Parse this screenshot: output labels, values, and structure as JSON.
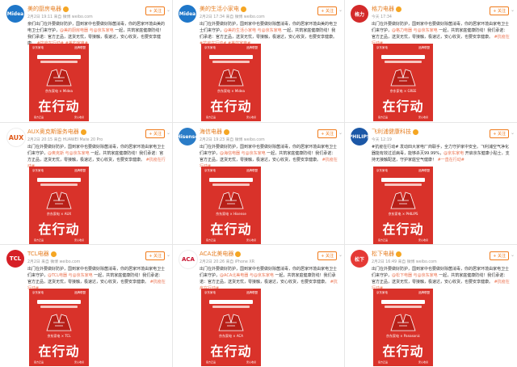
{
  "posts": [
    {
      "user": "美的厨房电器",
      "meta": "2月2日 19:11 来自 微博 weibo.com",
      "follow": "+ 关注",
      "avatar": "Midea",
      "text_a": "亲们出门在外要做好防护，国到家中也要做好除菌消毒，你的居家环境由美的电卫士们来守护，",
      "text_hl": "@美的厨房电器 与@京东家电",
      "text_b": " 一起，共筑家庭健康防线！我们承诺：官方正品，送货无忧，零接触，极速达，安心收货，也要安享健康。",
      "tags": "#抗疫在行动# #美的家电#",
      "brands": "京东家电 × Midea",
      "slogan": "在行动"
    },
    {
      "user": "美的生活小家电",
      "meta": "2月2日 17:34 来自 微博 weibo.com",
      "follow": "+ 关注",
      "avatar": "Midea",
      "text_a": "出门在外要做好防护，国到家中也要做好除菌消毒，你的居家环境由美的电卫士们来守护，",
      "text_hl": "@美的生活小家电 与@京东家电",
      "text_b": " 一起，共筑家庭健康防线！我们承诺：官方正品，送货无忧，零接触，极速达，安心收货，也要安享健康。",
      "tags": "#抗疫在行动# #美的家电#",
      "brands": "京东家电 × Midea",
      "slogan": "在行动"
    },
    {
      "user": "格力电器",
      "meta": "今天 17:34",
      "follow": "+ 关注",
      "avatar": "格力",
      "text_a": "出门在外要做好防护，国到家中也要做好除菌消毒，你的居家环境由家电卫士们来守护，",
      "text_hl": "@格力电器 与@京东家电",
      "text_b": " 一起，共筑家庭健康防线！我们承诺：官方正品，送货无忧，零接触，极速达，安心收货，也要安享健康。",
      "tags": "#抗疫在行动#",
      "brands": "京东家电 × GREE",
      "slogan": "在行动"
    },
    {
      "user": "AUX奥克斯服务电器",
      "meta": "2月2日 20:15 来自 HUAWEI Mate 20 Pro",
      "follow": "+ 关注",
      "avatar": "AUX",
      "text_a": "出门在外要做好防护，国到家中也要做好除菌消毒，你的居家环境由家电卫士们来守护，",
      "text_hl": "@奥克斯 与@京东家电",
      "text_b": " 一起，共筑家庭健康防线！我们承诺：官方正品，送货无忧，零接触，极速达，安心收货，也要安享健康。",
      "tags": "#抗疫在行动#",
      "brands": "京东家电 × AUX",
      "slogan": "在行动"
    },
    {
      "user": "海信电器",
      "meta": "2月2日 19:23 来自 微博 weibo.com",
      "follow": "+ 关注",
      "avatar": "Hisense",
      "text_a": "出门在外要做好防护，国到家中也要做好除菌消毒，你的居家环境由家电卫士们来守护，",
      "text_hl": "@海信电器 与@京东家电",
      "text_b": " 一起，共筑家庭健康防线！我们承诺：官方正品，送货无忧，零接触，极速达，安心收货，也要安享健康。",
      "tags": "#抗疫在行动#",
      "brands": "京东家电 × Hisense",
      "slogan": "在行动"
    },
    {
      "user": "飞利浦健康科技",
      "meta": "今天 12:19",
      "follow": "+ 关注",
      "avatar": "PHILIPS",
      "text_a": "#抗疫在行动# 发动四大家电厂商联手，全力守护家中安全。飞利浦空气净化器能有效过滤病毒，能够杀灭99.99%，",
      "text_hl": "@京东家电",
      "text_b": " 开启京东健康小贴士，支持无接触配送，守护家庭空气健康！",
      "tags": "#一直在行动#",
      "brands": "京东家电 × PHILIPS",
      "slogan": "在行动"
    },
    {
      "user": "TCL电器",
      "meta": "2月2日 来自 微博 weibo.com",
      "follow": "+ 关注",
      "avatar": "TCL",
      "text_a": "出门在外要做好防护，国到家中也要做好除菌消毒，你的居家环境由家电卫士们来守护，",
      "text_hl": "@TCL电器 与@京东家电",
      "text_b": " 一起，共筑家庭健康防线！我们承诺：官方正品，送货无忧，零接触，极速达，安心收货，也要安享健康。",
      "tags": "#抗疫在行动#",
      "brands": "京东家电 × TCL",
      "slogan": "在行动"
    },
    {
      "user": "ACA北美电器",
      "meta": "2月2日 20:26 来自 iPhone XR",
      "follow": "+ 关注",
      "avatar": "ACA",
      "text_a": "出门在外要做好防护，国到家中也要做好除菌消毒，你的居家环境由家电卫士们来守护，",
      "text_hl": "@ACA北美电器 与@京东家电",
      "text_b": " 一起，共筑家庭健康防线！我们承诺：官方正品，送货无忧，零接触，极速达，安心收货，也要安享健康。",
      "tags": "#抗疫在行动#",
      "brands": "京东家电 × ACA",
      "slogan": "在行动"
    },
    {
      "user": "松下电器",
      "meta": "2月2日 16:49 来自 微博 weibo.com",
      "follow": "+ 关注",
      "avatar": "松下",
      "text_a": "出门在外要做好防护，国到家中也要做好除菌消毒，你的居家环境由家电卫士们来守护，",
      "text_hl": "@松下电器 与@京东家电",
      "text_b": " 一起，共筑家庭健康防线！我们承诺：官方正品，送货无忧，零接触，极速达，安心收货，也要安享健康。",
      "tags": "#抗疫在行动#",
      "brands": "京东家电 × Panasonic",
      "slogan": "在行动"
    }
  ],
  "poster": {
    "top_left": "京东家电",
    "top_right": "品牌联盟",
    "foot_left": "官方正品",
    "foot_right": "安心收货"
  },
  "colors": {
    "accent": "#eb7350",
    "poster_red": "#d9322a",
    "follow": "#f07a1a"
  }
}
